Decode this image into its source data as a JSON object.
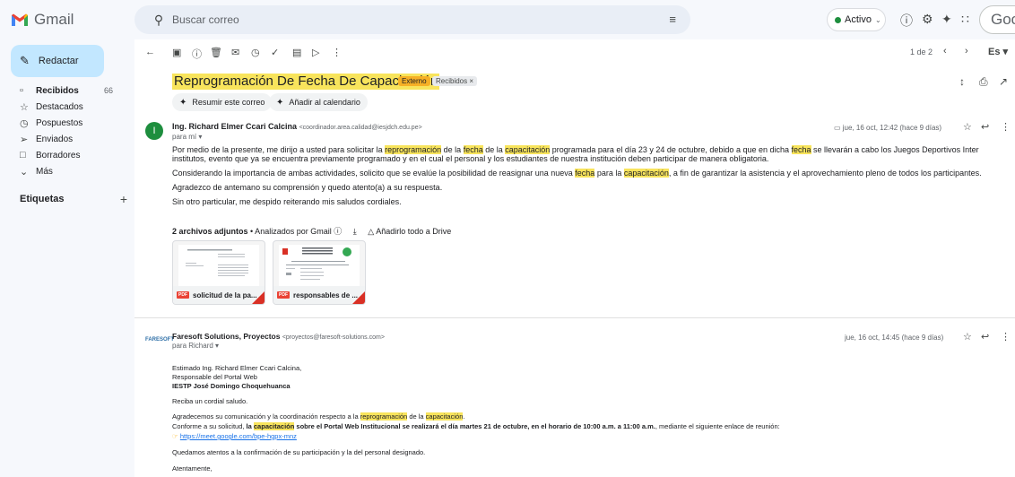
{
  "app": {
    "name": "Gmail",
    "brand_colors": [
      "#ea4335",
      "#fbbc04",
      "#34a853",
      "#4285f4"
    ]
  },
  "search": {
    "placeholder": "Buscar correo"
  },
  "topbar": {
    "status": "Activo",
    "account_initial": "Goog"
  },
  "sidebar": {
    "compose_label": "Redactar",
    "items": [
      {
        "label": "Recibidos",
        "count": "66",
        "icon": "inbox-icon",
        "active": true
      },
      {
        "label": "Destacados",
        "icon": "star-icon"
      },
      {
        "label": "Pospuestos",
        "icon": "clock-icon"
      },
      {
        "label": "Enviados",
        "icon": "send-icon"
      },
      {
        "label": "Borradores",
        "icon": "draft-icon"
      },
      {
        "label": "Más",
        "icon": "chevron-down-icon"
      }
    ],
    "labels_heading": "Etiquetas"
  },
  "toolbar": {
    "pager": "1 de 2",
    "lang": "Es"
  },
  "thread": {
    "subject": "Reprogramación De Fecha De Capacitación",
    "tags": [
      "Externo",
      "Recibidos ×"
    ],
    "chips": [
      "Resumir este correo",
      "Añadir al calendario"
    ]
  },
  "message1": {
    "avatar": "I",
    "sender": "Ing. Richard Elmer Ccari Calcina",
    "email": "<coordinador.area.calidad@iesjdch.edu.pe>",
    "to": "para mí ▾",
    "date": "jue, 16 oct, 12:42 (hace 9 días)",
    "p1a": "Por medio de la presente, me dirijo a usted para solicitar la ",
    "hl_reprog": "reprogramación",
    "p1b": " de la ",
    "hl_fecha": "fecha",
    "p1c": " de la ",
    "hl_cap": "capacitación",
    "p1d": " programada para el día 23 y 24 de octubre, debido a que en dicha ",
    "p1e": " se llevarán a cabo los Juegos Deportivos Inter",
    "p1f": "institutos, evento que ya se encuentra previamente programado y en el cual el personal y los estudiantes de nuestra institución deben participar de manera obligatoria.",
    "p2a": "Considerando la importancia de ambas actividades, solicito que se evalúe la posibilidad de reasignar una nueva ",
    "p2b": " para la ",
    "p2c": ", a fin de garantizar la asistencia y el aprovechamiento pleno de todos los participantes.",
    "p3": "Agradezco de antemano su comprensión y quedo atento(a) a su respuesta.",
    "p4": "Sin otro particular, me despido reiterando mis saludos cordiales.",
    "attach_count": "2 archivos adjuntos",
    "attach_scanned": " • Analizados por Gmail ⓘ",
    "attach_drive": "Añadirlo todo a Drive",
    "attachments": [
      {
        "name": "solicitud de la pa...",
        "type": "PDF"
      },
      {
        "name": "responsables de ...",
        "type": "PDF"
      }
    ]
  },
  "message2": {
    "avatar": "FARESOFT",
    "sender": "Faresoft Solutions, Proyectos",
    "email": "<proyectos@faresoft-solutions.com>",
    "to": "para Richard ▾",
    "date": "jue, 16 oct, 14:45 (hace 9 días)",
    "l1": "Estimado Ing. Richard Elmer Ccari Calcina,",
    "l2": "Responsable del Portal Web",
    "l3": "IESTP José Domingo Choquehuanca",
    "l4": "Reciba un cordial saludo.",
    "l5a": "Agradecemos su comunicación y la coordinación respecto a la ",
    "l5b": " de la ",
    "l5c": ".",
    "l6a": "Conforme a su solicitud, ",
    "l6b": "la ",
    "l6c": " sobre el Portal Web Institucional se realizará el día martes 21 de octubre, en el horario de 10:00 a.m. a 11:00 a.m.",
    "l6d": ", mediante el siguiente enlace de reunión:",
    "link": "https://meet.google.com/bpe-hgpx-mnz",
    "l8": "Quedamos atentos a la confirmación de su participación y la del personal designado.",
    "l9": "Atentamente,"
  }
}
